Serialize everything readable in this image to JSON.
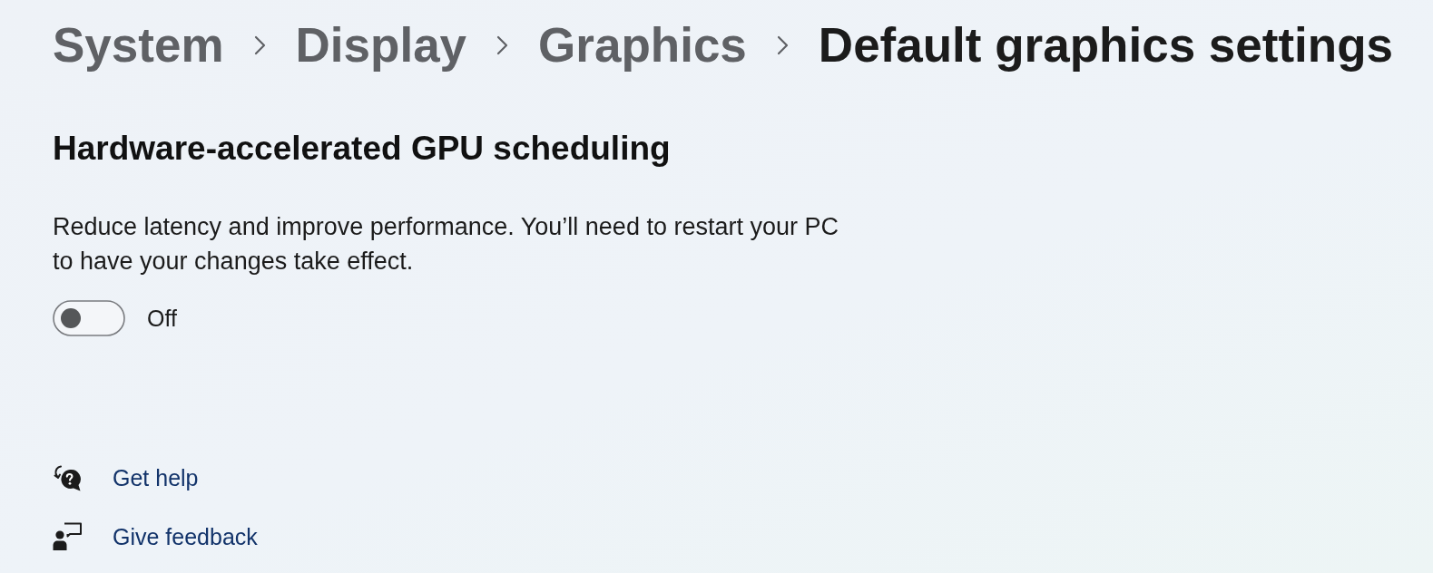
{
  "breadcrumb": [
    {
      "label": "System",
      "current": false
    },
    {
      "label": "Display",
      "current": false
    },
    {
      "label": "Graphics",
      "current": false
    },
    {
      "label": "Default graphics settings",
      "current": true
    }
  ],
  "setting": {
    "title": "Hardware-accelerated GPU scheduling",
    "description": "Reduce latency and improve performance. You’ll need to restart your PC to have your changes take effect.",
    "toggle": {
      "on": false,
      "label": "Off"
    }
  },
  "links": [
    {
      "kind": "help",
      "label": "Get help"
    },
    {
      "kind": "feedback",
      "label": "Give feedback"
    }
  ]
}
